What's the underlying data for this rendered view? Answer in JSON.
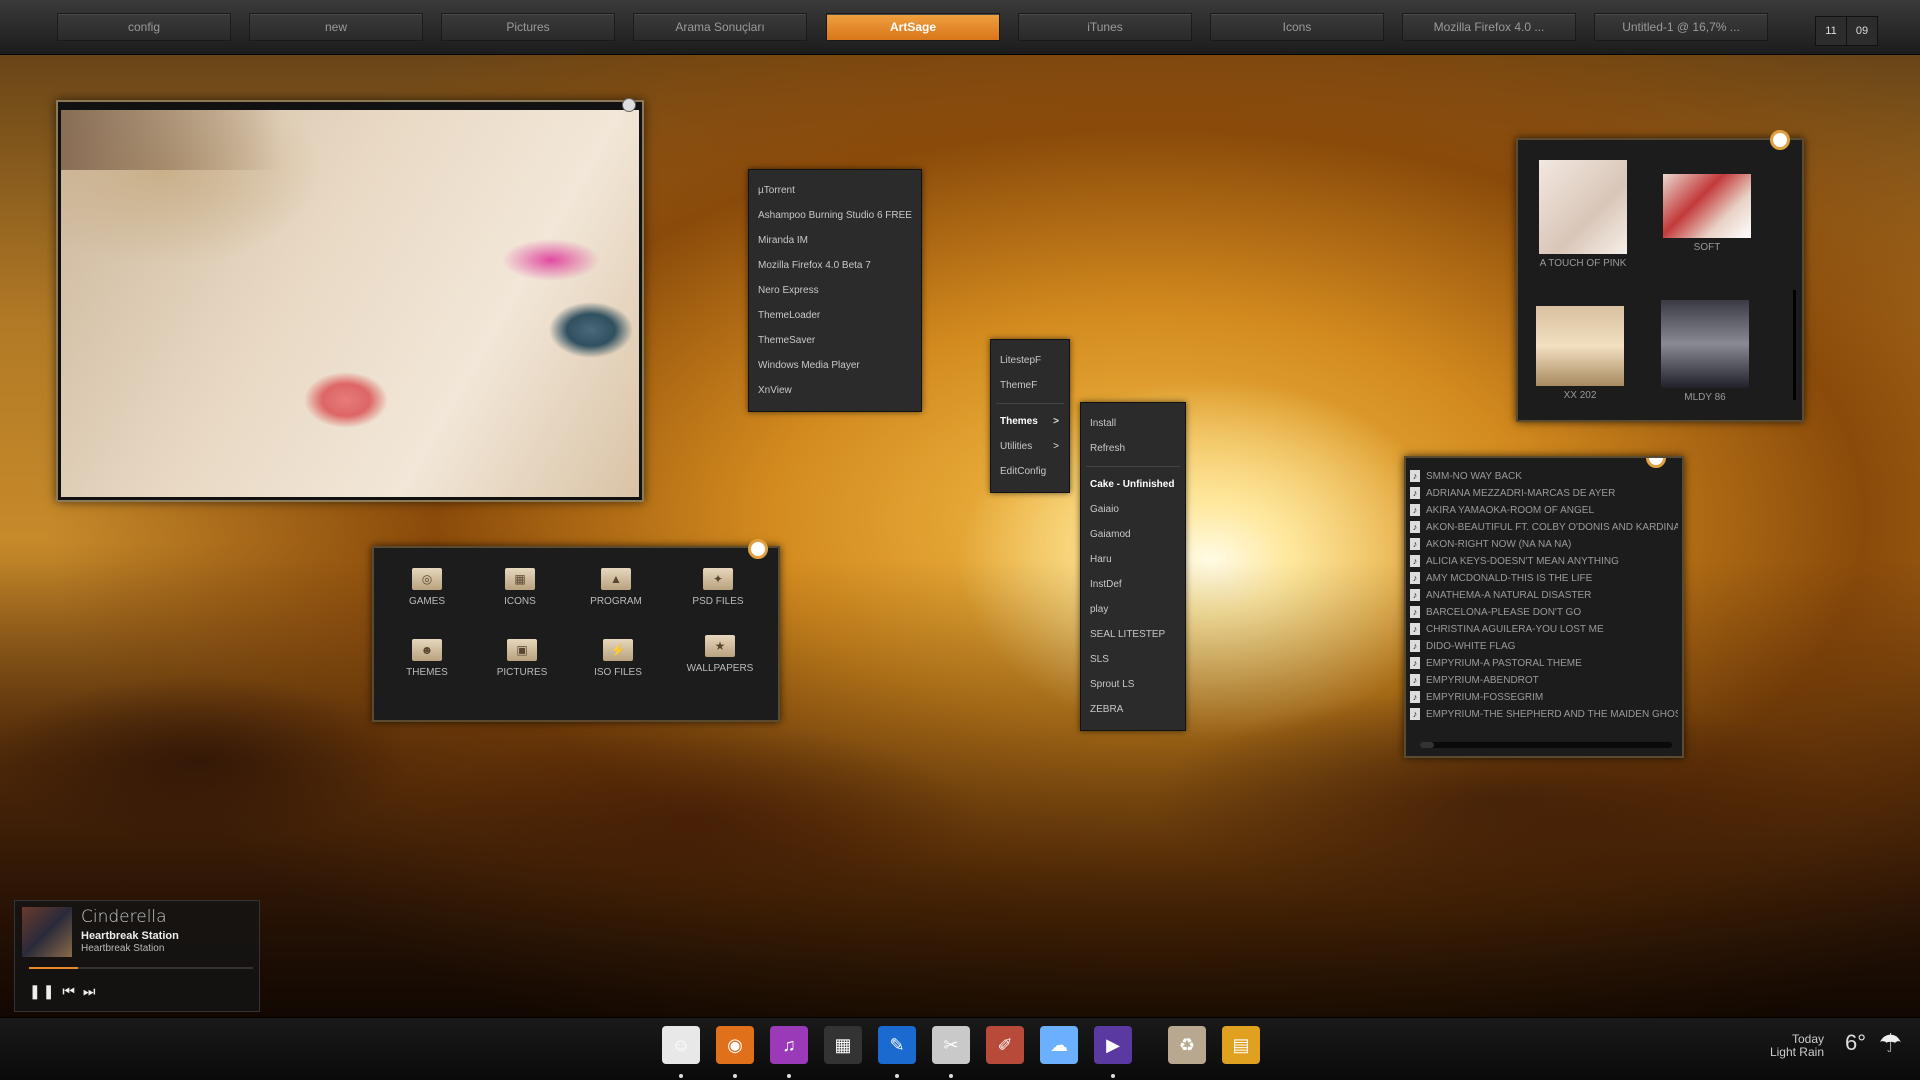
{
  "taskbar": {
    "tabs": [
      "config",
      "new",
      "Pictures",
      "Arama Sonuçları",
      "ArtSage",
      "iTunes",
      "Icons",
      "Mozilla Firefox 4.0 ...",
      "Untitled-1 @ 16,7% ..."
    ],
    "active_tab": "ArtSage",
    "clock_hour": "11",
    "clock_minute": "09"
  },
  "folders": {
    "items": [
      {
        "label": "GAMES",
        "icon": "gamepad-folder-icon"
      },
      {
        "label": "ICONS",
        "icon": "grid-folder-icon"
      },
      {
        "label": "PROGRAM",
        "icon": "app-folder-icon"
      },
      {
        "label": "PSD FILES",
        "icon": "psd-folder-icon"
      },
      {
        "label": "THEMES",
        "icon": "user-folder-icon"
      },
      {
        "label": "PICTURES",
        "icon": "image-folder-icon"
      },
      {
        "label": "ISO FILES",
        "icon": "disc-folder-icon"
      },
      {
        "label": "WALLPAPERS",
        "icon": "star-folder-icon"
      }
    ]
  },
  "programs_menu": {
    "items": [
      "µTorrent",
      "Ashampoo Burning Studio 6 FREE",
      "Miranda IM",
      "Mozilla Firefox 4.0 Beta 7",
      "Nero Express",
      "ThemeLoader",
      "ThemeSaver",
      "Windows Media Player",
      "XnView"
    ]
  },
  "litestep_menu": {
    "items": [
      "LitestepF",
      "ThemeF"
    ],
    "sub_items": [
      "Themes",
      "Utilities",
      "EditConfig"
    ],
    "arrow": ">"
  },
  "themes_menu": {
    "actions": [
      "Install",
      "Refresh"
    ],
    "themes": [
      "Cake - Unfinished",
      "Gaiaio",
      "Gaiamod",
      "Haru",
      "InstDef",
      "play",
      "SEAL LITESTEP",
      "SLS",
      "Sprout LS",
      "ZEBRA"
    ]
  },
  "gallery": {
    "items": [
      {
        "label": "A TOUCH OF PINK"
      },
      {
        "label": "SOFT"
      },
      {
        "label": "XX 202"
      },
      {
        "label": "MLDY 86"
      }
    ]
  },
  "playlist": {
    "tracks": [
      "SMM-NO WAY BACK",
      "ADRIANA MEZZADRI-MARCAS DE AYER",
      "AKIRA YAMAOKA-ROOM OF ANGEL",
      "AKON-BEAUTIFUL FT. COLBY O'DONIS AND KARDINAL OF",
      "AKON-RIGHT NOW (NA NA NA)",
      "ALICIA KEYS-DOESN'T MEAN ANYTHING",
      "AMY MCDONALD-THIS IS THE LIFE",
      "ANATHEMA-A NATURAL DISASTER",
      "BARCELONA-PLEASE DON'T GO",
      "CHRISTINA AGUILERA-YOU LOST ME",
      "DIDO-WHITE FLAG",
      "EMPYRIUM-A PASTORAL THEME",
      "EMPYRIUM-ABENDROT",
      "EMPYRIUM-FOSSEGRIM",
      "EMPYRIUM-THE SHEPHERD AND THE MAIDEN GHOST"
    ],
    "note_glyph": "♪"
  },
  "now_playing": {
    "title": "Cinderella",
    "artist": "Heartbreak Station",
    "album": "Heartbreak Station",
    "progress": 0.22,
    "pause_glyph": "❚❚",
    "prev_glyph": "⏮",
    "next_glyph": "⏭"
  },
  "dock": {
    "icons": [
      {
        "name": "finder-icon",
        "glyph": "☺",
        "color": "#e8e8e8",
        "running": true
      },
      {
        "name": "firefox-icon",
        "glyph": "◉",
        "color": "#e0701a",
        "running": true
      },
      {
        "name": "itunes-icon",
        "glyph": "♫",
        "color": "#9a3ab8",
        "running": true
      },
      {
        "name": "video-editor-icon",
        "glyph": "▦",
        "color": "#333333",
        "running": false
      },
      {
        "name": "mail-icon",
        "glyph": "✎",
        "color": "#1a6ad0",
        "running": true
      },
      {
        "name": "inkscape-icon",
        "glyph": "✂",
        "color": "#c9c9c9",
        "running": true
      },
      {
        "name": "css-editor-icon",
        "glyph": "✐",
        "color": "#b84a3a",
        "running": false
      },
      {
        "name": "cloud-icon",
        "glyph": "☁",
        "color": "#6ab0ff",
        "running": false
      },
      {
        "name": "media-player-icon",
        "glyph": "▶",
        "color": "#5a3aa0",
        "running": true
      },
      {
        "name": "recycle-bin-icon",
        "glyph": "♻",
        "color": "#b8a890",
        "running": false
      },
      {
        "name": "notes-icon",
        "glyph": "▤",
        "color": "#e0a020",
        "running": false
      }
    ]
  },
  "weather": {
    "day": "Today",
    "condition": "Light Rain",
    "temperature": "6°",
    "icon": "rain-cloud-icon",
    "icon_glyph": "☂"
  },
  "colors": {
    "accent": "#e88a2a",
    "panel": "#1c1c1c",
    "menu": "#2b2b2b"
  }
}
